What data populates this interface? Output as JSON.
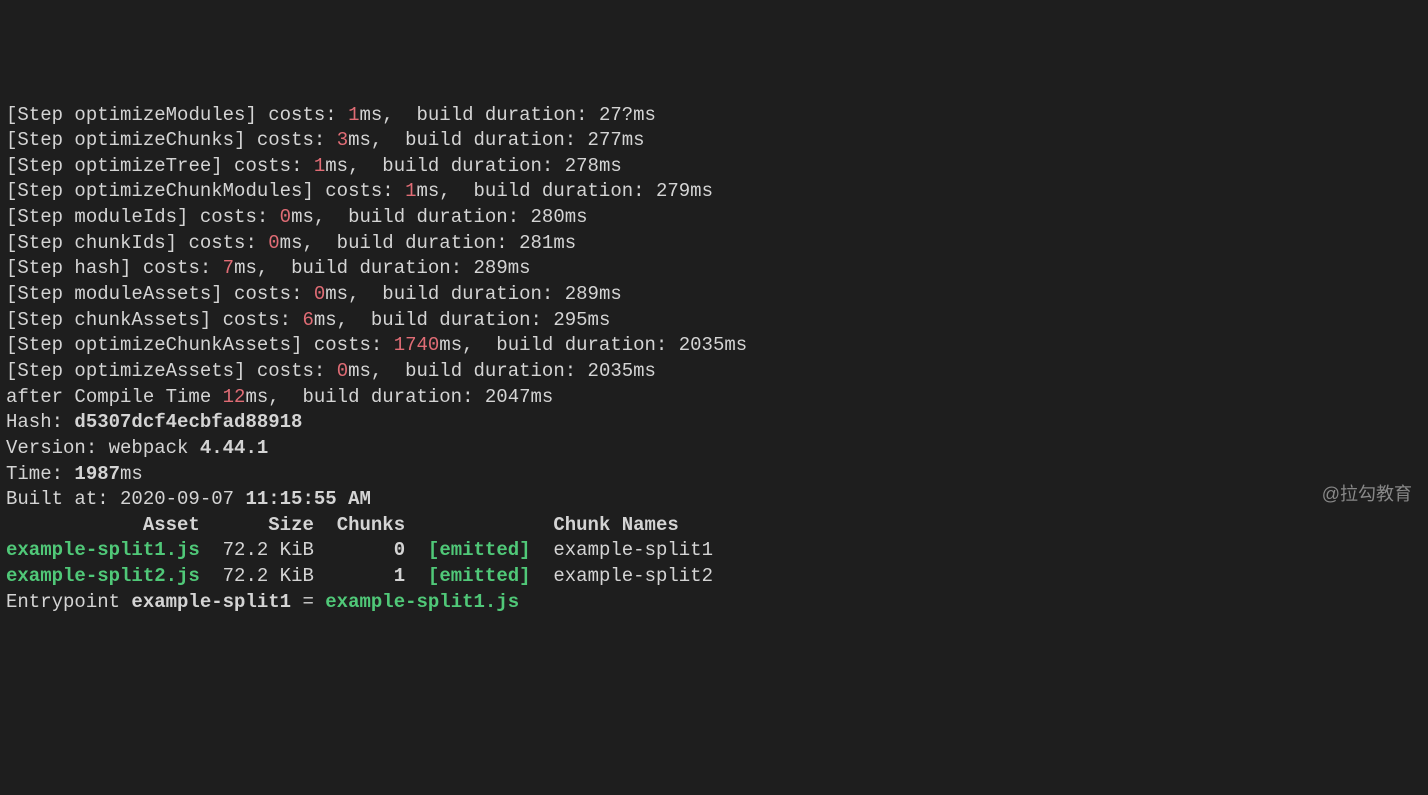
{
  "steps": [
    {
      "name": "optimizeModules",
      "cost": "1",
      "duration": "27?",
      "truncated_top": true
    },
    {
      "name": "optimizeChunks",
      "cost": "3",
      "duration": "277"
    },
    {
      "name": "optimizeTree",
      "cost": "1",
      "duration": "278"
    },
    {
      "name": "optimizeChunkModules",
      "cost": "1",
      "duration": "279"
    },
    {
      "name": "moduleIds",
      "cost": "0",
      "duration": "280"
    },
    {
      "name": "chunkIds",
      "cost": "0",
      "duration": "281"
    },
    {
      "name": "hash",
      "cost": "7",
      "duration": "289"
    },
    {
      "name": "moduleAssets",
      "cost": "0",
      "duration": "289"
    },
    {
      "name": "chunkAssets",
      "cost": "6",
      "duration": "295"
    },
    {
      "name": "optimizeChunkAssets",
      "cost": "1740",
      "duration": "2035"
    },
    {
      "name": "optimizeAssets",
      "cost": "0",
      "duration": "2035"
    }
  ],
  "afterCompile": {
    "time": "12",
    "duration": "2047"
  },
  "hash_label": "Hash: ",
  "hash_value": "d5307dcf4ecbfad88918",
  "version_label": "Version: webpack ",
  "version_value": "4.44.1",
  "time_label": "Time: ",
  "time_value": "1987",
  "time_unit": "ms",
  "built_at_label": "Built at: 2020-09-07 ",
  "built_at_value": "11:15:55 AM",
  "table_headers": {
    "asset": "Asset",
    "size": "Size",
    "chunks": "Chunks",
    "chunk_names": "Chunk Names"
  },
  "assets": [
    {
      "name": "example-split1.js",
      "size": "72.2 KiB",
      "chunk": "0",
      "status": "[emitted]",
      "chunk_name": "example-split1"
    },
    {
      "name": "example-split2.js",
      "size": "72.2 KiB",
      "chunk": "1",
      "status": "[emitted]",
      "chunk_name": "example-split2"
    }
  ],
  "entrypoint_label": "Entrypoint ",
  "entrypoint_name": "example-split1",
  "entrypoint_sep": " = ",
  "entrypoint_file": "example-split1.js",
  "watermark": "@拉勾教育"
}
